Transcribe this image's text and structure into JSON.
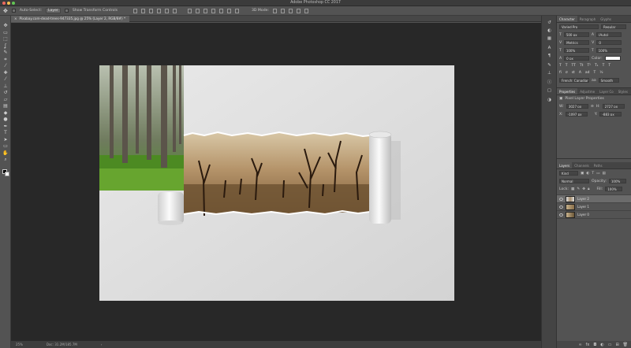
{
  "window": {
    "title": "Adobe Photoshop CC 2017"
  },
  "options_bar": {
    "auto_select_label": "Auto-Select:",
    "auto_select_value": "Layer",
    "transform_label": "Show Transform Controls",
    "mode_3d_label": "3D Mode:"
  },
  "document": {
    "tab_title": "Pixabay.com-dead-trees-947335.jpg @ 25% (Layer 2, RGB/8#) *"
  },
  "tools": [
    {
      "name": "move",
      "glyph": "✥"
    },
    {
      "name": "artboard",
      "glyph": "▭"
    },
    {
      "name": "marquee",
      "glyph": "⬚"
    },
    {
      "name": "lasso",
      "glyph": "ʆ"
    },
    {
      "name": "quick-select",
      "glyph": "✎"
    },
    {
      "name": "crop",
      "glyph": "⌗"
    },
    {
      "name": "eyedropper",
      "glyph": "⁄"
    },
    {
      "name": "heal",
      "glyph": "✚"
    },
    {
      "name": "brush",
      "glyph": "⁄"
    },
    {
      "name": "stamp",
      "glyph": "⊥"
    },
    {
      "name": "history-brush",
      "glyph": "↺"
    },
    {
      "name": "eraser",
      "glyph": "▱"
    },
    {
      "name": "gradient",
      "glyph": "▤"
    },
    {
      "name": "blur",
      "glyph": "◆"
    },
    {
      "name": "dodge",
      "glyph": "●"
    },
    {
      "name": "pen",
      "glyph": "✒"
    },
    {
      "name": "type",
      "glyph": "T"
    },
    {
      "name": "path-select",
      "glyph": "➤"
    },
    {
      "name": "shape",
      "glyph": "▭"
    },
    {
      "name": "hand",
      "glyph": "✋"
    },
    {
      "name": "zoom",
      "glyph": "⌕"
    }
  ],
  "character": {
    "tabs": [
      "Character",
      "Paragraph",
      "Glyphs"
    ],
    "font_family": "Varied Pro",
    "font_style": "Regular",
    "size": "500 px",
    "leading": "(Auto)",
    "kerning": "Metrics",
    "tracking": "0",
    "vscale": "100%",
    "hscale": "100%",
    "baseline": "0 px",
    "color_label": "Color:",
    "language": "French: Canadian",
    "aa": "Smooth",
    "aa_label": "aa"
  },
  "properties": {
    "tabs": [
      "Properties",
      "Adjustme",
      "Layer Co",
      "Styles"
    ],
    "heading": "Pixel Layer Properties",
    "w": "3027 px",
    "h": "2727 px",
    "x": "-1097 px",
    "y": "-883 px",
    "w_label": "W:",
    "h_label": "H:",
    "x_label": "X:",
    "y_label": "Y:",
    "go_label": "GO"
  },
  "layers_panel": {
    "tabs": [
      "Layers",
      "Channels",
      "Paths"
    ],
    "filter_kind": "Kind",
    "blend_mode": "Normal",
    "opacity_label": "Opacity:",
    "opacity": "100%",
    "lock_label": "Lock:",
    "fill_label": "Fill:",
    "fill": "100%",
    "layers": [
      {
        "name": "Layer 2",
        "selected": true
      },
      {
        "name": "Layer 1",
        "selected": false
      },
      {
        "name": "Layer 0",
        "selected": false
      }
    ]
  },
  "status": {
    "zoom": "25%",
    "doc": "Doc: 31.2M/185.7M"
  },
  "colors": {
    "accent": "#1f75d1",
    "workspace": "#282828",
    "panel": "#535353"
  }
}
